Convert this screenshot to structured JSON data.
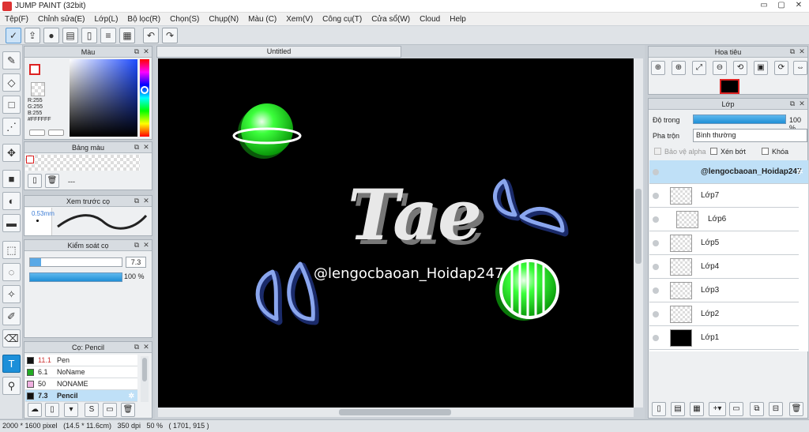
{
  "window": {
    "title": "JUMP PAINT (32bit)",
    "min": "▭",
    "max": "▢",
    "close": "✕"
  },
  "menu": [
    "Tệp(F)",
    "Chỉnh sửa(E)",
    "Lớp(L)",
    "Bộ lọc(R)",
    "Chọn(S)",
    "Chụp(N)",
    "Màu (C)",
    "Xem(V)",
    "Công cụ(T)",
    "Cửa sổ(W)",
    "Cloud",
    "Help"
  ],
  "toolbar": {
    "icons": [
      "check-icon",
      "share-icon",
      "comment-icon",
      "chat-icon",
      "page-icon",
      "document-icon",
      "grid-icon",
      "undo-icon",
      "redo-icon"
    ]
  },
  "document": {
    "tab_title": "Untitled"
  },
  "color_panel": {
    "title": "Màu",
    "rgb": {
      "r": "R:255",
      "g": "G:255",
      "b": "B:255",
      "hex": "#FFFFFF"
    },
    "foreground": "#ffffff",
    "accent": "#d22"
  },
  "palette_panel": {
    "title": "Bảng màu",
    "value": "---"
  },
  "brush_preview": {
    "title": "Xem trước cọ",
    "size": "0.53mm"
  },
  "brush_control": {
    "title": "Kiểm soát cọ",
    "size_value": "7.3",
    "opacity_value": "100 %"
  },
  "brush_list": {
    "title": "Cọ: Pencil",
    "items": [
      {
        "size": "11.1",
        "name": "Pen",
        "color": "#111111"
      },
      {
        "size": "6.1",
        "name": "NoName",
        "color": "#22aa22"
      },
      {
        "size": "50",
        "name": "NONAME",
        "color": "#f0b0e0"
      },
      {
        "size": "7.3",
        "name": "Pencil",
        "color": "#111111"
      }
    ]
  },
  "navigator": {
    "title": "Hoa tiêu"
  },
  "layer_panel": {
    "title": "Lớp",
    "opacity_label": "Độ trong",
    "opacity_value": "100 %",
    "blend_label": "Pha trộn",
    "blend_value": "Bình thường",
    "protect_alpha": "Bảo vệ alpha",
    "clipping": "Xén bớt",
    "lock": "Khóa",
    "layers": [
      "@lengocbaoan_Hoidap247",
      "Lớp7",
      "Lớp6",
      "Lớp5",
      "Lớp4",
      "Lớp3",
      "Lớp2",
      "Lớp1"
    ]
  },
  "canvas_art": {
    "headline": "Tae",
    "signature": "@lengocbaoan_Hoidap247",
    "green": "#27e827",
    "blue": "#8aa6ee"
  },
  "status_bar": {
    "pixel_size": "2000 * 1600 pixel",
    "physical_size": "(14.5 * 11.6cm)",
    "dpi": "350 dpi",
    "zoom": "50 %",
    "coords": "( 1701, 915 )"
  }
}
